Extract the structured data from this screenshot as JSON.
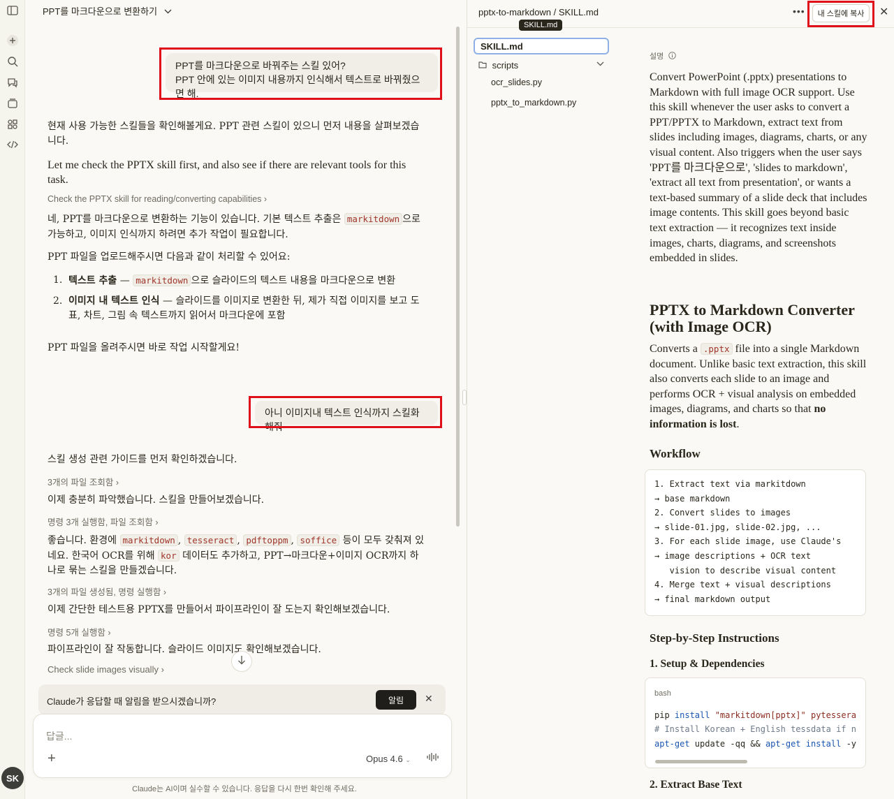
{
  "chat": {
    "title": "PPT를 마크다운으로 변환하기",
    "user_msg_1": [
      "PPT를 마크다운으로 바꿔주는 스킬 있어?",
      "PPT 안에 있는 이미지 내용까지 인식해서 텍스트로 바꿔줬으면 해."
    ],
    "p1": "현재 사용 가능한 스킬들을 확인해볼게요. PPT 관련 스킬이 있으니 먼저 내용을 살펴보겠습니다.",
    "p2": "Let me check the PPTX skill first, and also see if there are relevant tools for this task.",
    "tool1": "Check the PPTX skill for reading/converting capabilities",
    "p3_a": "네, PPT를 마크다운으로 변환하는 기능이 있습니다. 기본 텍스트 추출은",
    "p3_code": "markitdown",
    "p3_b": "으로 가능하고, 이미지 인식까지 하려면 추가 작업이 필요합니다.",
    "p4": "PPT 파일을 업로드해주시면 다음과 같이 처리할 수 있어요:",
    "list": [
      {
        "num": "1.",
        "bold": "텍스트 추출",
        "dash": " — ",
        "code": "markitdown",
        "rest": "으로 슬라이드의 텍스트 내용을 마크다운으로 변환"
      },
      {
        "num": "2.",
        "bold": "이미지 내 텍스트 인식",
        "dash": " — ",
        "rest": "슬라이드를 이미지로 변환한 뒤, 제가 직접 이미지를 보고 도표, 차트, 그림 속 텍스트까지 읽어서 마크다운에 포함"
      }
    ],
    "p5": "PPT 파일을 올려주시면 바로 작업 시작할게요!",
    "user_msg_2": "아니 이미지내 텍스트 인식까지 스킬화해줘",
    "p6": "스킬 생성 관련 가이드를 먼저 확인하겠습니다.",
    "tool2": "3개의 파일 조회함",
    "p7": "이제 충분히 파악했습니다. 스킬을 만들어보겠습니다.",
    "tool3": "명령 3개 실행함, 파일 조회함",
    "p8_a": "좋습니다. 환경에",
    "p8_codes": [
      "markitdown",
      "tesseract",
      "pdftoppm",
      "soffice"
    ],
    "p8_b": "등이 모두 갖춰져 있네요. 한국어 OCR를 위해",
    "p8_code2": "kor",
    "p8_c": "데이터도 추가하고, PPT→마크다운+이미지 OCR까지 하나로 묶는 스킬을 만들겠습니다.",
    "tool4": "3개의 파일 생성됨, 명령 실행함",
    "p9": "이제 간단한 테스트용 PPTX를 만들어서 파이프라인이 잘 도는지 확인해보겠습니다.",
    "tool5": "명령 5개 실행함",
    "p10": "파이프라인이 잘 작동합니다. 슬라이드 이미지도 확인해보겠습니다.",
    "tool6": "Check slide images visually",
    "notify_text": "Claude가 응답할 때 알림을 받으시겠습니까?",
    "notify_btn": "알림",
    "placeholder": "답글...",
    "model": "Opus 4.6",
    "disclaimer": "Claude는 AI이며 실수할 수 있습니다. 응답을 다시 한번 확인해 주세요."
  },
  "user": {
    "initials": "SK"
  },
  "panel": {
    "path": "pptx-to-markdown / SKILL.md",
    "tooltip": "SKILL.md",
    "copy_label": "내 스킬에 복사",
    "files": {
      "selected": "SKILL.md",
      "folder": "scripts",
      "children": [
        "ocr_slides.py",
        "pptx_to_markdown.py"
      ]
    },
    "doc": {
      "label": "설명",
      "description": "Convert PowerPoint (.pptx) presentations to Markdown with full image OCR support. Use this skill whenever the user asks to convert a PPT/PPTX to Markdown, extract text from slides including images, diagrams, charts, or any visual content. Also triggers when the user says 'PPT를 마크다운으로', 'slides to markdown', 'extract all text from presentation', or wants a text-based summary of a slide deck that includes image contents. This skill goes beyond basic text extraction — it recognizes text inside images, charts, diagrams, and screenshots embedded in slides.",
      "title": "PPTX to Markdown Converter (with Image OCR)",
      "intro_a": "Converts a",
      "intro_code": ".pptx",
      "intro_b": "file into a single Markdown document. Unlike basic text extraction, this skill also converts each slide to an image and performs OCR + visual analysis on embedded images, diagrams, and charts so that",
      "intro_bold": "no information is lost",
      "intro_end": ".",
      "workflow_title": "Workflow",
      "workflow_lines": [
        "1. Extract text via markitdown",
        "→ base markdown",
        "2. Convert slides to images",
        "→ slide-01.jpg, slide-02.jpg, ...",
        "3. For each slide image, use Claude's",
        "→ image descriptions + OCR text",
        "   vision to describe visual content",
        "4. Merge text + visual descriptions",
        "→ final markdown output"
      ],
      "steps_title": "Step-by-Step Instructions",
      "step1_title": "1. Setup & Dependencies",
      "code_lang": "bash",
      "code_l1": {
        "a": "pip ",
        "b": "install",
        "c": " \"markitdown[pptx]\" pytessera"
      },
      "code_l2": "# Install Korean + English tessdata if n",
      "code_l3": {
        "a": "apt-get",
        "b": " update -qq && ",
        "c": "apt-get",
        "d": " ",
        "e": "install",
        "f": " -y"
      },
      "step2_title": "2. Extract Base Text"
    }
  }
}
